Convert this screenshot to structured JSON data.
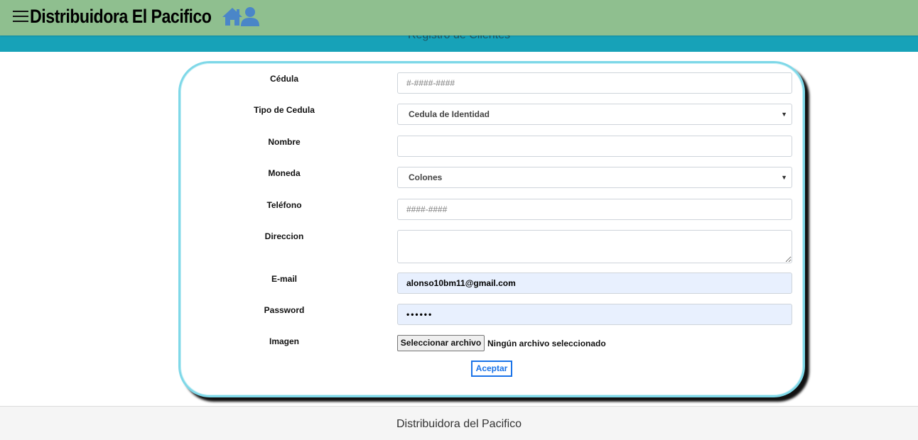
{
  "header": {
    "brand": "Distribuidora El Pacifico",
    "menu_icon": "hamburger-menu-icon",
    "home_icon": "home-icon",
    "user_icon": "user-icon",
    "bg_color": "#8fbf8f"
  },
  "subheader": {
    "title": "Registro de Clientes",
    "bg_color": "#17a2b8"
  },
  "form": {
    "cedula": {
      "label": "Cédula",
      "placeholder": "#-####-####",
      "value": ""
    },
    "tipo_cedula": {
      "label": "Tipo de Cedula",
      "selected": "Cedula de Identidad"
    },
    "nombre": {
      "label": "Nombre",
      "value": ""
    },
    "moneda": {
      "label": "Moneda",
      "selected": "Colones"
    },
    "telefono": {
      "label": "Teléfono",
      "placeholder": "####-####",
      "value": ""
    },
    "direccion": {
      "label": "Direccion",
      "value": ""
    },
    "email": {
      "label": "E-mail",
      "value": "alonso10bm11@gmail.com"
    },
    "password": {
      "label": "Password",
      "value": "••••••"
    },
    "imagen": {
      "label": "Imagen",
      "button_label": "Seleccionar archivo",
      "status": "Ningún archivo seleccionado"
    },
    "submit_label": "Aceptar",
    "card_border_color": "#7fd8e8"
  },
  "footer": {
    "text": "Distribuidora del Pacifico"
  }
}
